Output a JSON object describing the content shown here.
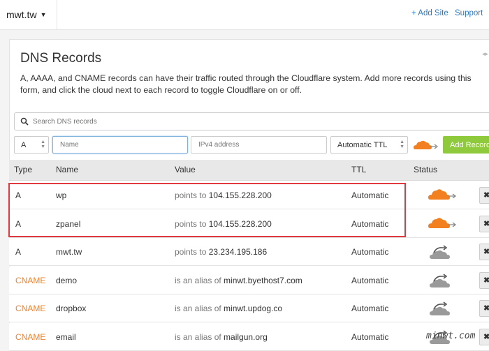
{
  "topbar": {
    "domain": "mwt.tw",
    "add_site": "+ Add Site",
    "support": "Support"
  },
  "dns": {
    "title": "DNS Records",
    "description": "A, AAAA, and CNAME records can have their traffic routed through the Cloudflare system. Add more records using this form, and click the cloud next to each record to toggle Cloudflare on or off.",
    "search_placeholder": "Search DNS records",
    "form": {
      "type": "A",
      "name_placeholder": "Name",
      "ip_placeholder": "IPv4 address",
      "ttl": "Automatic TTL",
      "add_button": "Add Record"
    },
    "columns": [
      "Type",
      "Name",
      "Value",
      "TTL",
      "Status"
    ],
    "records": [
      {
        "type": "A",
        "name": "wp",
        "value_prefix": "points to",
        "value": "104.155.228.200",
        "ttl": "Automatic",
        "proxied": true
      },
      {
        "type": "A",
        "name": "zpanel",
        "value_prefix": "points to",
        "value": "104.155.228.200",
        "ttl": "Automatic",
        "proxied": true
      },
      {
        "type": "A",
        "name": "mwt.tw",
        "value_prefix": "points to",
        "value": "23.234.195.186",
        "ttl": "Automatic",
        "proxied": false
      },
      {
        "type": "CNAME",
        "name": "demo",
        "value_prefix": "is an alias of",
        "value": "minwt.byethost7.com",
        "ttl": "Automatic",
        "proxied": false
      },
      {
        "type": "CNAME",
        "name": "dropbox",
        "value_prefix": "is an alias of",
        "value": "minwt.updog.co",
        "ttl": "Automatic",
        "proxied": false
      },
      {
        "type": "CNAME",
        "name": "email",
        "value_prefix": "is an alias of",
        "value": "mailgun.org",
        "ttl": "Automatic",
        "proxied": false
      }
    ],
    "delete_symbol": "✖"
  },
  "watermark": "minwt.com",
  "colors": {
    "accent_orange": "#f38020",
    "cname_orange": "#f0822e",
    "add_green": "#8fca3d",
    "link_blue": "#2f7bbf",
    "highlight_red": "#e03a3f",
    "cloud_grey": "#9a9a9a"
  }
}
